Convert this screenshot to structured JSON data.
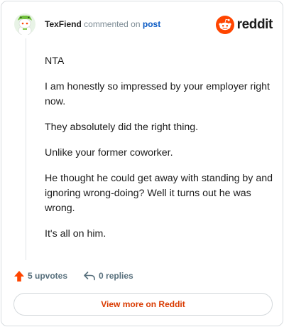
{
  "header": {
    "username": "TexFiend",
    "verb": "commented on",
    "post_link": "post",
    "brand_wordmark": "reddit"
  },
  "comment": {
    "paragraphs": [
      "NTA",
      "I am honestly so impressed by your employer right now.",
      "They absolutely did the right thing.",
      "Unlike your former coworker.",
      "He thought he could get away with standing by and ignoring wrong-doing? Well it turns out he was wrong.",
      "It's all on him."
    ]
  },
  "actions": {
    "upvotes_label": "5 upvotes",
    "replies_label": "0 replies"
  },
  "footer": {
    "view_more_label": "View more on Reddit"
  },
  "icons": {
    "avatar": "avatar-icon",
    "logo": "reddit-logo-icon",
    "upvote": "upvote-arrow-icon",
    "reply": "reply-arrow-icon"
  },
  "colors": {
    "brand": "#ff4500",
    "upvote": "#ff4500",
    "link": "#0a5ac4",
    "view_more": "#d93a00",
    "muted": "#576f7c"
  }
}
